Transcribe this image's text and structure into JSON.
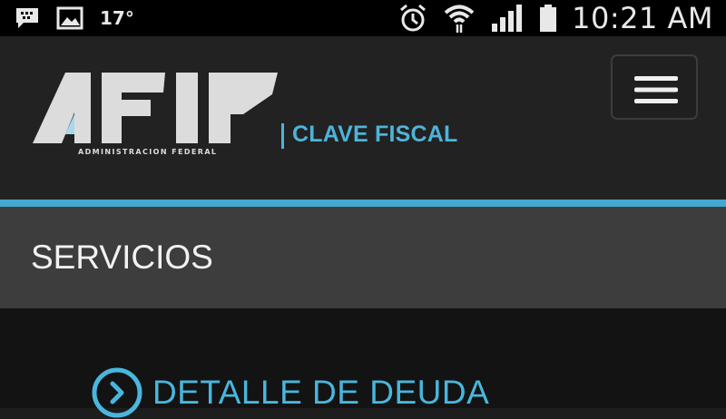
{
  "status_bar": {
    "temperature": "17°",
    "time": "10:21 AM",
    "left_icons": [
      "chat-icon",
      "image-icon"
    ],
    "right_icons": [
      "alarm-icon",
      "wifi-icon",
      "signal-icon",
      "battery-icon"
    ]
  },
  "header": {
    "logo_text": "AFIP",
    "logo_subtitle": "ADMINISTRACION FEDERAL",
    "brand_label": "CLAVE FISCAL",
    "menu_icon": "hamburger-menu-icon"
  },
  "section": {
    "title": "SERVICIOS"
  },
  "services": [
    {
      "label": "DETALLE DE DEUDA",
      "icon": "chevron-right-circle-icon"
    }
  ],
  "colors": {
    "accent": "#43a8cf",
    "link": "#49b6dd",
    "status_bar_bg": "#000000",
    "header_bg": "#222222",
    "section_bg": "#3d3d3d",
    "content_bg": "#131313"
  }
}
